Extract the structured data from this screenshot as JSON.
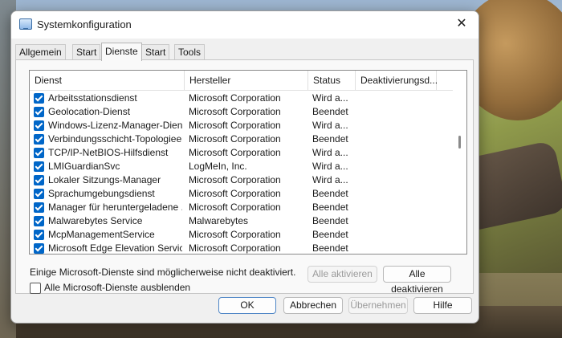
{
  "window": {
    "title": "Systemkonfiguration",
    "close": "✕"
  },
  "tabs": [
    {
      "label": "Allgemein"
    },
    {
      "label": "Start"
    },
    {
      "label": "Dienste"
    },
    {
      "label": "Start"
    },
    {
      "label": "Tools"
    }
  ],
  "table": {
    "columns": [
      "Dienst",
      "Hersteller",
      "Status",
      "Deaktivierungsd..."
    ],
    "rows": [
      {
        "name": "Arbeitsstationsdienst",
        "vendor": "Microsoft Corporation",
        "status": "Wird a...",
        "checked": true
      },
      {
        "name": "Geolocation-Dienst",
        "vendor": "Microsoft Corporation",
        "status": "Beendet",
        "checked": true
      },
      {
        "name": "Windows-Lizenz-Manager-Dienst",
        "vendor": "Microsoft Corporation",
        "status": "Wird a...",
        "checked": true
      },
      {
        "name": "Verbindungsschicht-Topologieer...",
        "vendor": "Microsoft Corporation",
        "status": "Beendet",
        "checked": true
      },
      {
        "name": "TCP/IP-NetBIOS-Hilfsdienst",
        "vendor": "Microsoft Corporation",
        "status": "Wird a...",
        "checked": true
      },
      {
        "name": "LMIGuardianSvc",
        "vendor": "LogMeIn, Inc.",
        "status": "Wird a...",
        "checked": true
      },
      {
        "name": "Lokaler Sitzungs-Manager",
        "vendor": "Microsoft Corporation",
        "status": "Wird a...",
        "checked": true
      },
      {
        "name": "Sprachumgebungsdienst",
        "vendor": "Microsoft Corporation",
        "status": "Beendet",
        "checked": true
      },
      {
        "name": "Manager für heruntergeladene ...",
        "vendor": "Microsoft Corporation",
        "status": "Beendet",
        "checked": true
      },
      {
        "name": "Malwarebytes Service",
        "vendor": "Malwarebytes",
        "status": "Beendet",
        "checked": true
      },
      {
        "name": "McpManagementService",
        "vendor": "Microsoft Corporation",
        "status": "Beendet",
        "checked": true
      },
      {
        "name": "Microsoft Edge Elevation Service...",
        "vendor": "Microsoft Corporation",
        "status": "Beendet",
        "checked": true
      }
    ]
  },
  "note": "Einige Microsoft-Dienste sind möglicherweise nicht deaktiviert.",
  "buttons": {
    "enable_all": "Alle aktivieren",
    "disable_all": "Alle deaktivieren",
    "ok": "OK",
    "cancel": "Abbrechen",
    "apply": "Übernehmen",
    "help": "Hilfe"
  },
  "hide_ms": {
    "label": "Alle Microsoft-Dienste ausblenden",
    "checked": false
  },
  "colors": {
    "accent": "#0066c8",
    "window_bg": "#f0f0f0",
    "panel_bg": "#f9f9f9"
  }
}
